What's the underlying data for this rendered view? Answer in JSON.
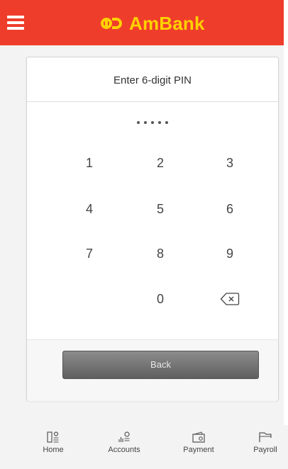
{
  "header": {
    "brand": "AmBank",
    "brand_color": "#ef3d2b",
    "logo_color": "#ffd100",
    "menu_icon": "hamburger-icon"
  },
  "pin": {
    "title": "Enter 6-digit PIN",
    "entered_digits": 5,
    "keys": [
      "1",
      "2",
      "3",
      "4",
      "5",
      "6",
      "7",
      "8",
      "9",
      "0"
    ],
    "delete_icon": "backspace-icon",
    "back_label": "Back"
  },
  "bottom_nav": {
    "items": [
      {
        "label": "Home",
        "icon": "home-icon"
      },
      {
        "label": "Accounts",
        "icon": "accounts-icon"
      },
      {
        "label": "Payment",
        "icon": "payment-icon"
      },
      {
        "label": "Payroll",
        "icon": "payroll-icon"
      }
    ]
  }
}
